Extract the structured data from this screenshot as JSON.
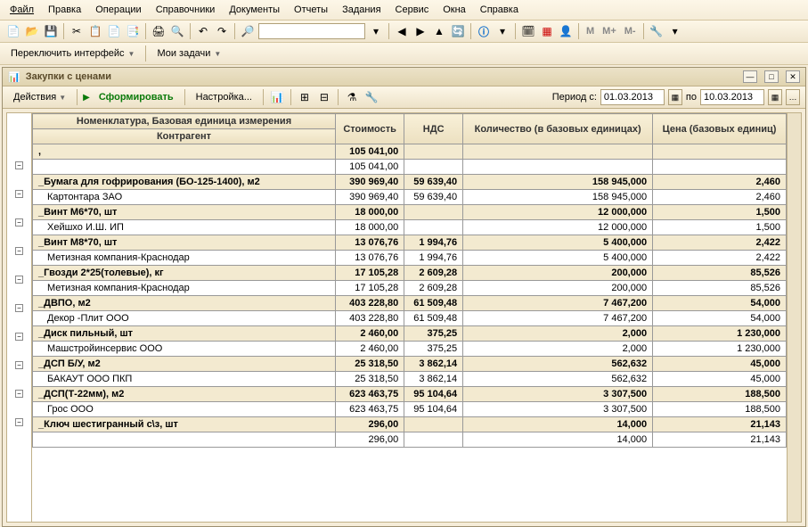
{
  "menu": [
    "Файл",
    "Правка",
    "Операции",
    "Справочники",
    "Документы",
    "Отчеты",
    "Задания",
    "Сервис",
    "Окна",
    "Справка"
  ],
  "secbar": {
    "switch": "Переключить интерфейс",
    "tasks": "Мои задачи"
  },
  "toolbar_text": {
    "m": "M",
    "mplus": "M+",
    "mminus": "M-"
  },
  "window": {
    "title": "Закупки с ценами"
  },
  "actions": {
    "actions": "Действия",
    "form": "Сформировать",
    "settings": "Настройка...",
    "period_label": "Период с:",
    "date_from": "01.03.2013",
    "to": "по",
    "date_to": "10.03.2013"
  },
  "headers": {
    "name1": "Номенклатура, Базовая единица измерения",
    "name2": "Контрагент",
    "cost": "Стоимость",
    "vat": "НДС",
    "qty": "Количество (в базовых единицах)",
    "price": "Цена (базовых единиц)"
  },
  "rows": [
    {
      "type": "group",
      "name": ",",
      "cost": "105 041,00",
      "vat": "",
      "qty": "",
      "price": ""
    },
    {
      "type": "detail",
      "name": "",
      "cost": "105 041,00",
      "vat": "",
      "qty": "",
      "price": ""
    },
    {
      "type": "group",
      "name": "_Бумага для гофрирования (БО-125-1400), м2",
      "cost": "390 969,40",
      "vat": "59 639,40",
      "qty": "158 945,000",
      "price": "2,460"
    },
    {
      "type": "detail",
      "name": "Картонтара ЗАО",
      "cost": "390 969,40",
      "vat": "59 639,40",
      "qty": "158 945,000",
      "price": "2,460"
    },
    {
      "type": "group",
      "name": "_Винт М6*70, шт",
      "cost": "18 000,00",
      "vat": "",
      "qty": "12 000,000",
      "price": "1,500"
    },
    {
      "type": "detail",
      "name": "Хейшхо И.Ш. ИП",
      "cost": "18 000,00",
      "vat": "",
      "qty": "12 000,000",
      "price": "1,500"
    },
    {
      "type": "group",
      "name": "_Винт М8*70, шт",
      "cost": "13 076,76",
      "vat": "1 994,76",
      "qty": "5 400,000",
      "price": "2,422"
    },
    {
      "type": "detail",
      "name": "Метизная компания-Краснодар",
      "cost": "13 076,76",
      "vat": "1 994,76",
      "qty": "5 400,000",
      "price": "2,422"
    },
    {
      "type": "group",
      "name": "_Гвозди 2*25(толевые), кг",
      "cost": "17 105,28",
      "vat": "2 609,28",
      "qty": "200,000",
      "price": "85,526"
    },
    {
      "type": "detail",
      "name": "Метизная компания-Краснодар",
      "cost": "17 105,28",
      "vat": "2 609,28",
      "qty": "200,000",
      "price": "85,526"
    },
    {
      "type": "group",
      "name": "_ДВПО, м2",
      "cost": "403 228,80",
      "vat": "61 509,48",
      "qty": "7 467,200",
      "price": "54,000"
    },
    {
      "type": "detail",
      "name": "Декор -Плит ООО",
      "cost": "403 228,80",
      "vat": "61 509,48",
      "qty": "7 467,200",
      "price": "54,000"
    },
    {
      "type": "group",
      "name": "_Диск пильный, шт",
      "cost": "2 460,00",
      "vat": "375,25",
      "qty": "2,000",
      "price": "1 230,000"
    },
    {
      "type": "detail",
      "name": "Машстройинсервис ООО",
      "cost": "2 460,00",
      "vat": "375,25",
      "qty": "2,000",
      "price": "1 230,000"
    },
    {
      "type": "group",
      "name": "_ДСП Б/У, м2",
      "cost": "25 318,50",
      "vat": "3 862,14",
      "qty": "562,632",
      "price": "45,000"
    },
    {
      "type": "detail",
      "name": "БАКАУТ ООО ПКП",
      "cost": "25 318,50",
      "vat": "3 862,14",
      "qty": "562,632",
      "price": "45,000"
    },
    {
      "type": "group",
      "name": "_ДСП(Т-22мм), м2",
      "cost": "623 463,75",
      "vat": "95 104,64",
      "qty": "3 307,500",
      "price": "188,500"
    },
    {
      "type": "detail",
      "name": "Грос ООО",
      "cost": "623 463,75",
      "vat": "95 104,64",
      "qty": "3 307,500",
      "price": "188,500"
    },
    {
      "type": "group",
      "name": "_Ключ шестигранный с\\з, шт",
      "cost": "296,00",
      "vat": "",
      "qty": "14,000",
      "price": "21,143"
    },
    {
      "type": "detail",
      "name": "",
      "cost": "296,00",
      "vat": "",
      "qty": "14,000",
      "price": "21,143"
    }
  ]
}
